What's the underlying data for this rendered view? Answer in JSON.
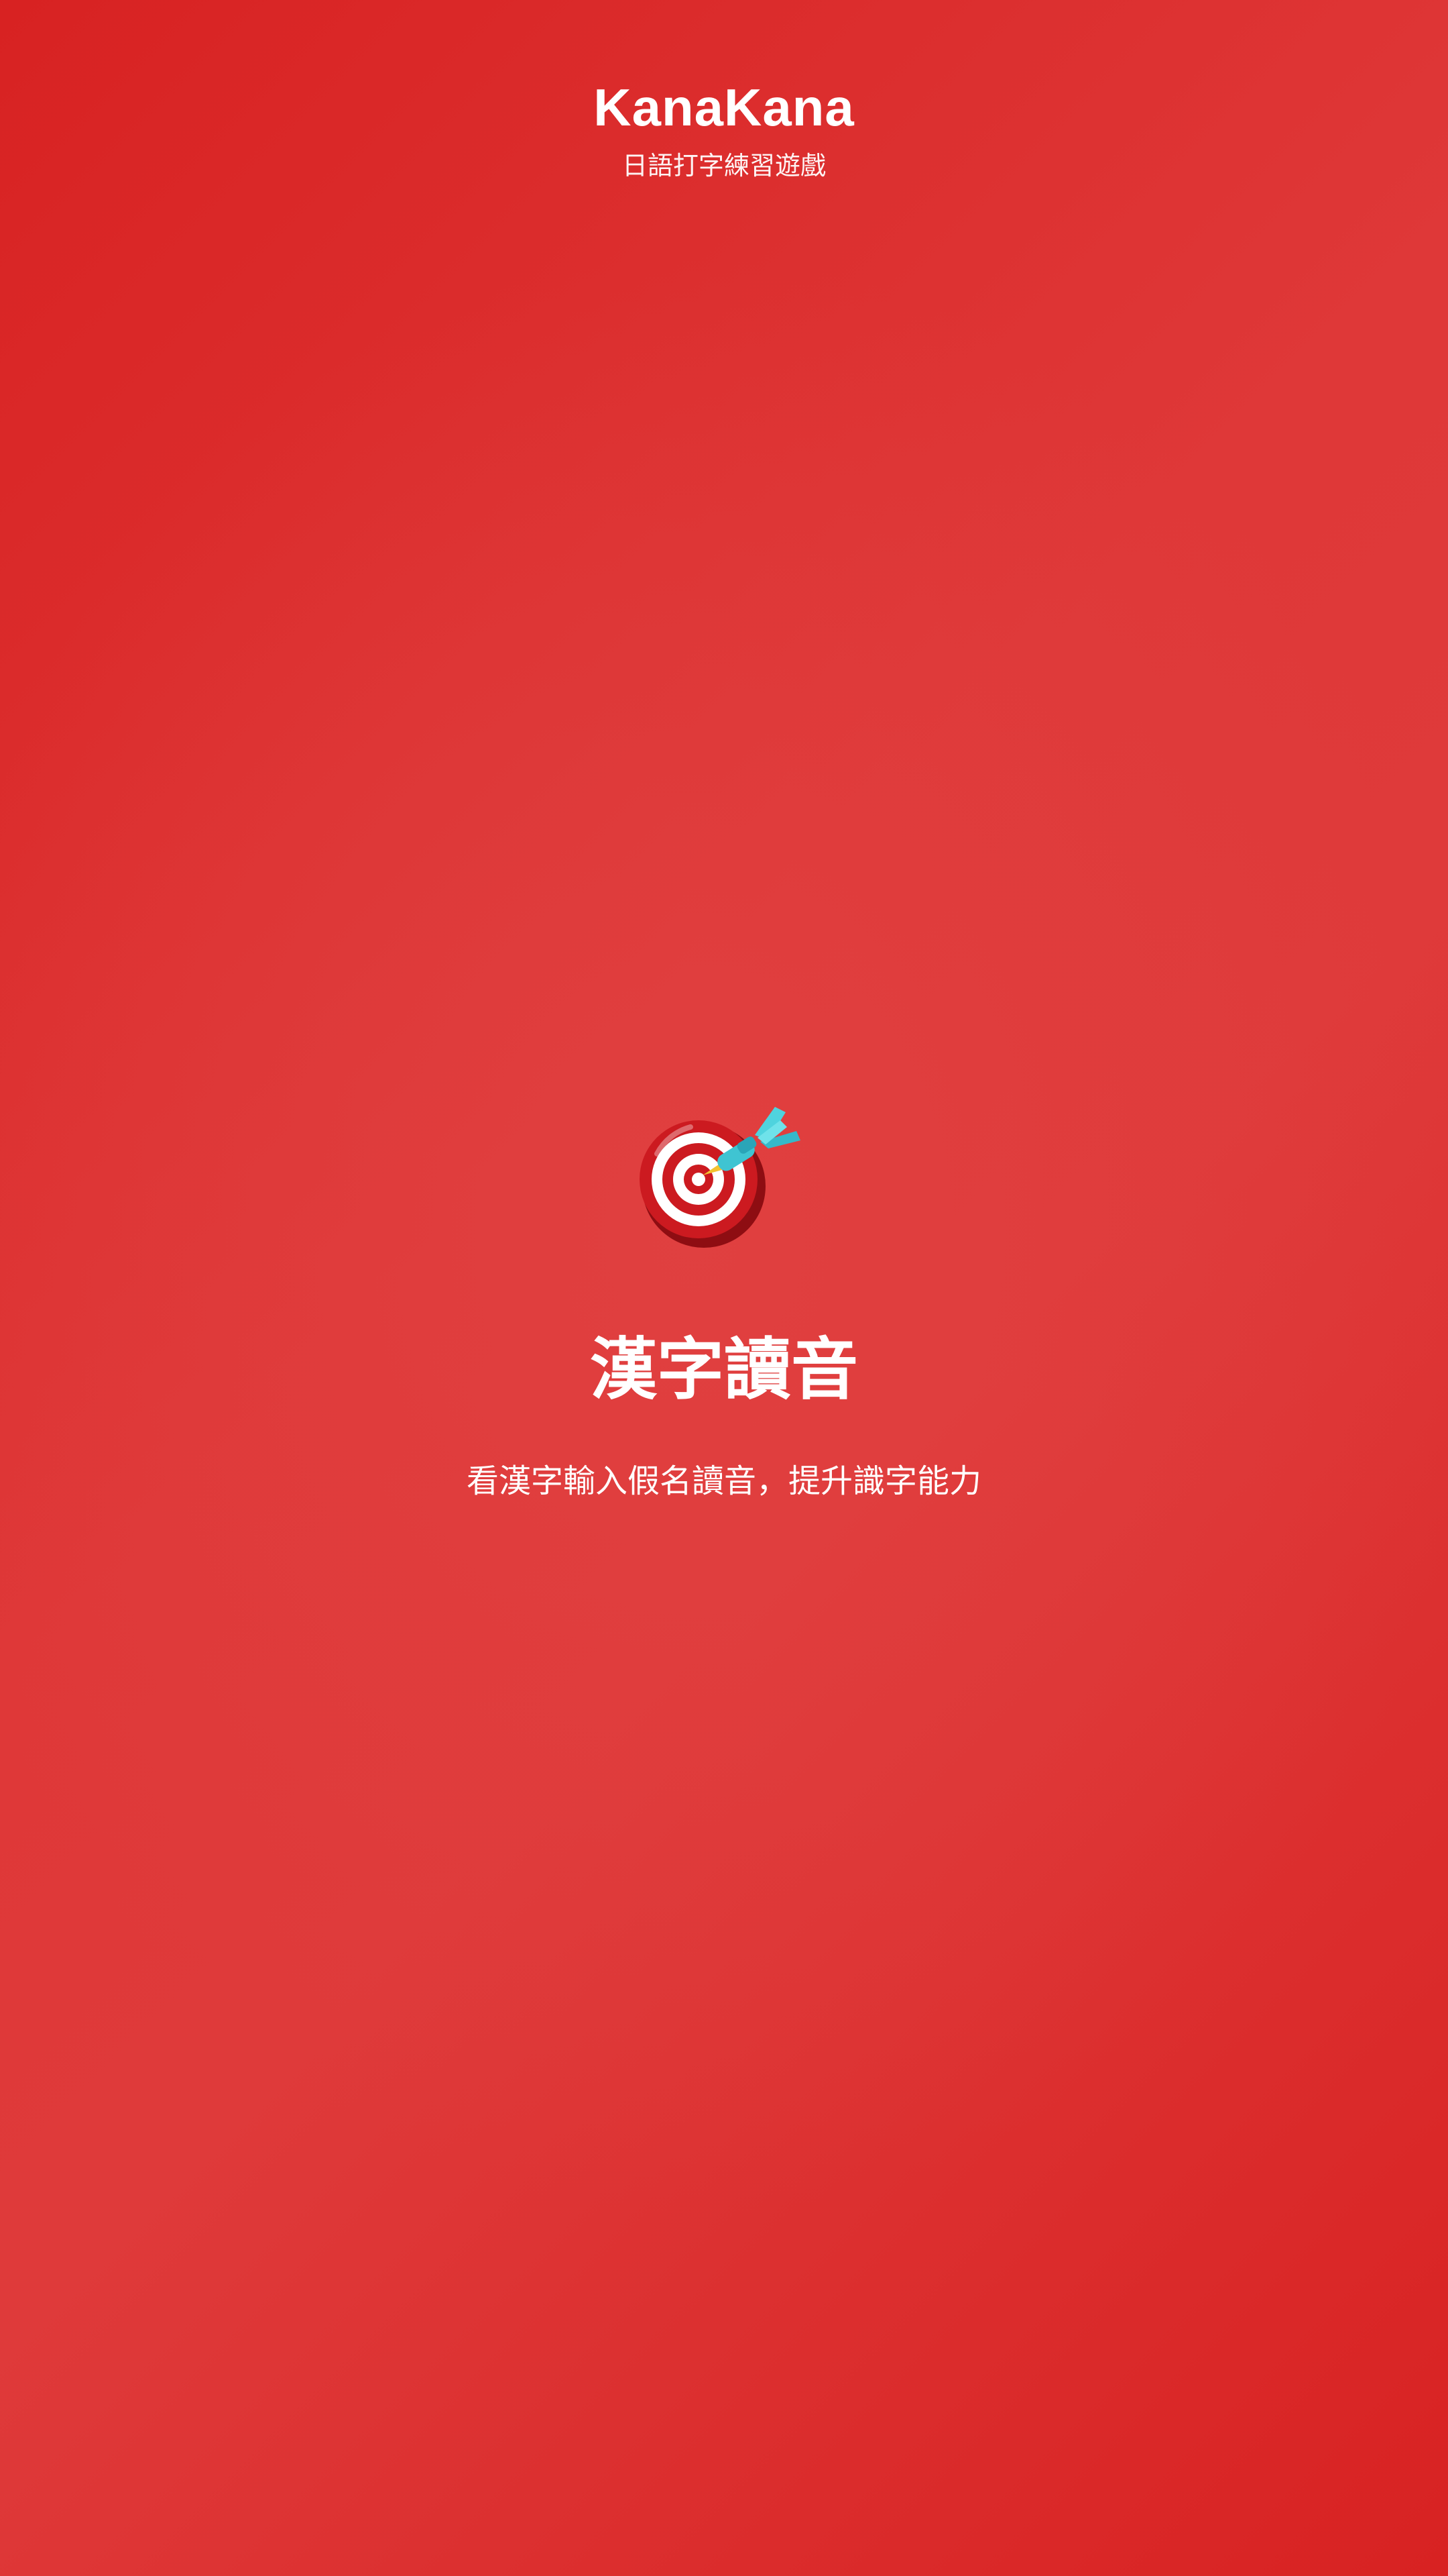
{
  "header": {
    "title": "KanaKana",
    "subtitle": "日語打字練習遊戲"
  },
  "hero": {
    "icon": "target-dart-icon",
    "title": "漢字讀音",
    "description": "看漢字輸入假名讀音，提升識字能力"
  },
  "colors": {
    "background": "#dc2c2c",
    "text": "#ffffff",
    "target_red": "#c8161d",
    "dart_teal": "#3fc4d2"
  }
}
